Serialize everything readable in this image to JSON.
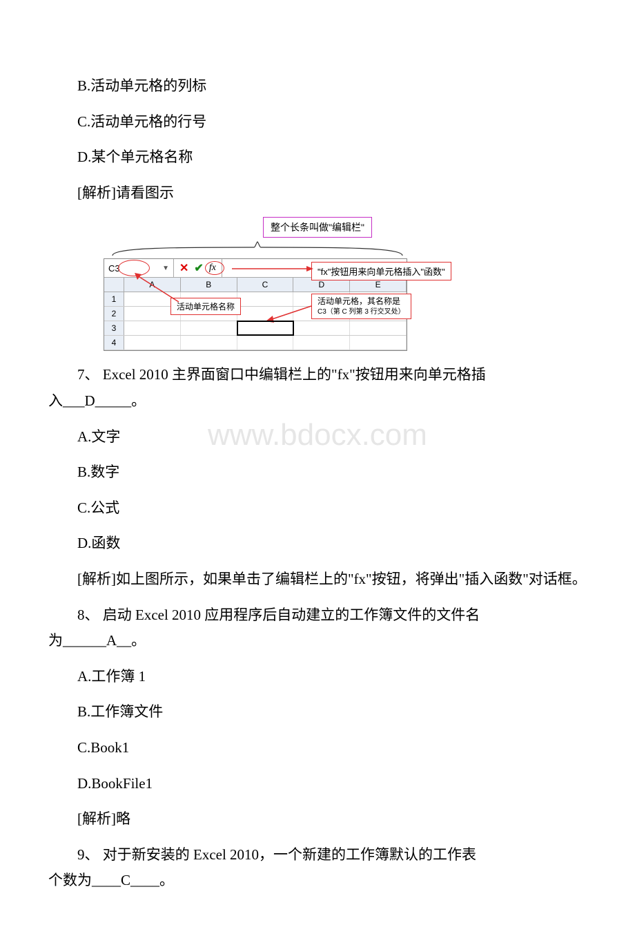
{
  "watermark": "www.bdocx.com",
  "options_before": {
    "b": "B.活动单元格的列标",
    "c": "C.活动单元格的行号",
    "d": "D.某个单元格名称",
    "analysis": " [解析]请看图示"
  },
  "diagram": {
    "title_label": "整个长条叫做\"编辑栏\"",
    "namebox": "C3",
    "fx": "fx",
    "col_headers": [
      "A",
      "B",
      "C",
      "D",
      "E"
    ],
    "row_headers": [
      "1",
      "2",
      "3",
      "4"
    ],
    "callout_fx": "\"fx\"按钮用来向单元格插入\"函数\"",
    "callout_namebox": "活动单元格名称",
    "callout_activecell": "活动单元格，其名称是",
    "callout_activecell_sub": "C3（第 C 列第 3 行交叉处）"
  },
  "q7": {
    "text_before": "7、 Excel 2010 主界面窗口中编辑栏上的\"fx\"按钮用来向单元格插",
    "text_after": "入___D_____。",
    "a": "A.文字",
    "b": "B.数字",
    "c": "C.公式",
    "d": "D.函数",
    "analysis": "[解析]如上图所示，如果单击了编辑栏上的\"fx\"按钮，将弹出\"插入函数\"对话框。"
  },
  "q8": {
    "text_before": "8、 启动 Excel 2010 应用程序后自动建立的工作簿文件的文件名",
    "text_after": "为______A__。",
    "a": "A.工作簿 1",
    "b": "B.工作簿文件",
    "c": "C.Book1",
    "d": "D.BookFile1",
    "analysis": " [解析]略"
  },
  "q9": {
    "text_before": "9、 对于新安装的 Excel 2010，一个新建的工作簿默认的工作表",
    "text_after": "个数为____C____。"
  }
}
